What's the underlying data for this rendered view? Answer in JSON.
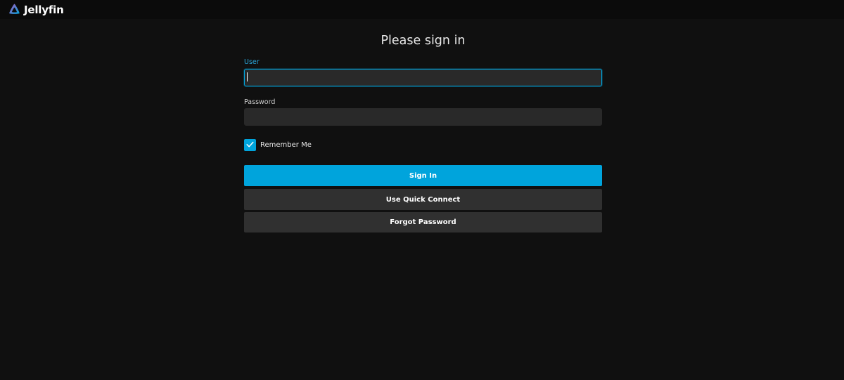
{
  "app": {
    "name": "Jellyfin"
  },
  "page": {
    "title": "Please sign in"
  },
  "form": {
    "user_label": "User",
    "user_value": "",
    "password_label": "Password",
    "password_value": "",
    "remember_me_label": "Remember Me",
    "remember_me_checked": true,
    "sign_in_label": "Sign In",
    "quick_connect_label": "Use Quick Connect",
    "forgot_password_label": "Forgot Password"
  },
  "colors": {
    "accent": "#00a4dc",
    "background": "#101010",
    "header": "#0b0b0b",
    "input_bg": "#292929",
    "secondary_button": "#303030"
  },
  "icons": {
    "logo": "jellyfin-logo-icon",
    "checkbox": "checkmark-icon"
  }
}
